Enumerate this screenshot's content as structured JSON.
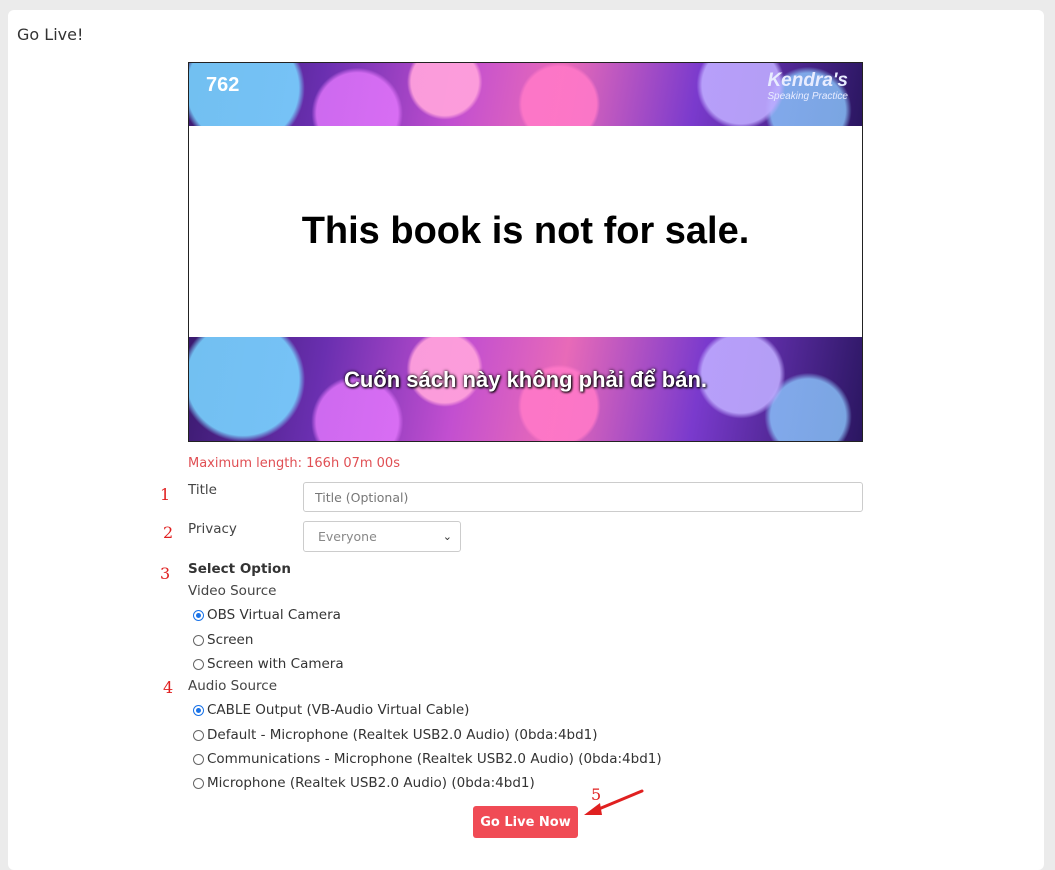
{
  "page": {
    "title": "Go Live!"
  },
  "preview": {
    "number": "762",
    "brand_name": "Kendra's",
    "brand_subtitle": "Speaking Practice",
    "main_text": "This book is not for sale.",
    "sub_text": "Cuốn sách này không phải để bán."
  },
  "max_length": "Maximum length: 166h 07m 00s",
  "markers": [
    "1",
    "2",
    "3",
    "4",
    "5"
  ],
  "form": {
    "title_label": "Title",
    "title_placeholder": "Title (Optional)",
    "privacy_label": "Privacy",
    "privacy_value": "Everyone",
    "select_option_label": "Select Option",
    "video_source_label": "Video Source",
    "video_options": [
      "OBS Virtual Camera",
      "Screen",
      "Screen with Camera"
    ],
    "video_selected": "OBS Virtual Camera",
    "audio_source_label": "Audio Source",
    "audio_options": [
      "CABLE Output (VB-Audio Virtual Cable)",
      "Default - Microphone (Realtek USB2.0 Audio) (0bda:4bd1)",
      "Communications - Microphone (Realtek USB2.0 Audio) (0bda:4bd1)",
      "Microphone (Realtek USB2.0 Audio) (0bda:4bd1)"
    ],
    "audio_selected": "CABLE Output (VB-Audio Virtual Cable)"
  },
  "go_live_button": "Go Live Now",
  "colors": {
    "accent": "#f04b55",
    "annotation": "#e02020",
    "radio": "#1a73e8"
  }
}
